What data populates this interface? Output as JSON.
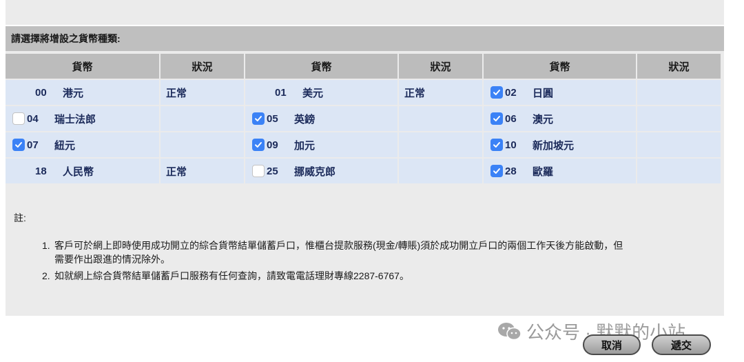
{
  "section_title": "請選擇將增設之貨幣種類:",
  "columns": {
    "currency": "貨幣",
    "status": "狀況"
  },
  "rows": [
    [
      {
        "code": "00",
        "name": "港元",
        "checkbox": "none",
        "status": "正常"
      },
      {
        "code": "01",
        "name": "美元",
        "checkbox": "none",
        "status": "正常"
      },
      {
        "code": "02",
        "name": "日圓",
        "checkbox": "checked",
        "status": ""
      }
    ],
    [
      {
        "code": "04",
        "name": "瑞士法郎",
        "checkbox": "unchecked",
        "status": ""
      },
      {
        "code": "05",
        "name": "英鎊",
        "checkbox": "checked",
        "status": ""
      },
      {
        "code": "06",
        "name": "澳元",
        "checkbox": "checked",
        "status": ""
      }
    ],
    [
      {
        "code": "07",
        "name": "紐元",
        "checkbox": "checked",
        "status": ""
      },
      {
        "code": "09",
        "name": "加元",
        "checkbox": "checked",
        "status": ""
      },
      {
        "code": "10",
        "name": "新加坡元",
        "checkbox": "checked",
        "status": ""
      }
    ],
    [
      {
        "code": "18",
        "name": "人民幣",
        "checkbox": "none",
        "status": "正常"
      },
      {
        "code": "25",
        "name": "挪威克郎",
        "checkbox": "unchecked",
        "status": ""
      },
      {
        "code": "28",
        "name": "歐羅",
        "checkbox": "checked",
        "status": ""
      }
    ]
  ],
  "notes": {
    "title": "註:",
    "items": [
      {
        "num": "1.",
        "text": "客戶可於網上即時使用成功開立的綜合貨幣結單儲蓄戶口，惟櫃台提款服務(現金/轉賬)須於成功開立戶口的兩個工作天後方能啟動，但需要作出跟進的情況除外。"
      },
      {
        "num": "2.",
        "text": "如就網上綜合貨幣結單儲蓄戶口服務有任何查詢，請致電電話理財專線2287-6767。"
      }
    ]
  },
  "watermark": "公众号 · 默默的小站",
  "buttons": {
    "cancel": "取消",
    "submit": "遞交"
  },
  "colors": {
    "checkbox_checked": "#3b82f6",
    "row_bg": "#dce6f5",
    "header_bg": "#bcbcbc"
  }
}
